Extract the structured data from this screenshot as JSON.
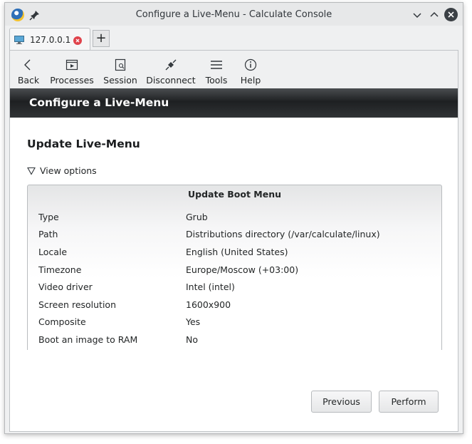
{
  "window": {
    "title": "Configure a Live-Menu - Calculate Console"
  },
  "tabs": [
    {
      "label": "127.0.0.1"
    }
  ],
  "new_tab_label": "+",
  "toolbar": {
    "items": [
      {
        "label": "Back",
        "icon": "back-arrow-icon"
      },
      {
        "label": "Processes",
        "icon": "processes-icon"
      },
      {
        "label": "Session",
        "icon": "session-icon"
      },
      {
        "label": "Disconnect",
        "icon": "disconnect-icon"
      },
      {
        "label": "Tools",
        "icon": "hamburger-icon"
      },
      {
        "label": "Help",
        "icon": "info-icon"
      }
    ]
  },
  "page_header": "Configure a Live-Menu",
  "section_title": "Update Live-Menu",
  "view_options": "View options",
  "panel": {
    "title": "Update Boot Menu",
    "rows": [
      {
        "label": "Type",
        "value": "Grub"
      },
      {
        "label": "Path",
        "value": "Distributions directory (/var/calculate/linux)"
      },
      {
        "label": "Locale",
        "value": "English (United States)"
      },
      {
        "label": "Timezone",
        "value": "Europe/Moscow (+03:00)"
      },
      {
        "label": "Video driver",
        "value": "Intel (intel)"
      },
      {
        "label": "Screen resolution",
        "value": "1600x900"
      },
      {
        "label": "Composite",
        "value": "Yes"
      },
      {
        "label": "Boot an image to RAM",
        "value": "No"
      }
    ]
  },
  "buttons": {
    "previous": "Previous",
    "perform": "Perform"
  },
  "colors": {
    "header_dark": "#1e2022",
    "tab_close": "#e0424b",
    "window_bg": "#eff0f1"
  }
}
